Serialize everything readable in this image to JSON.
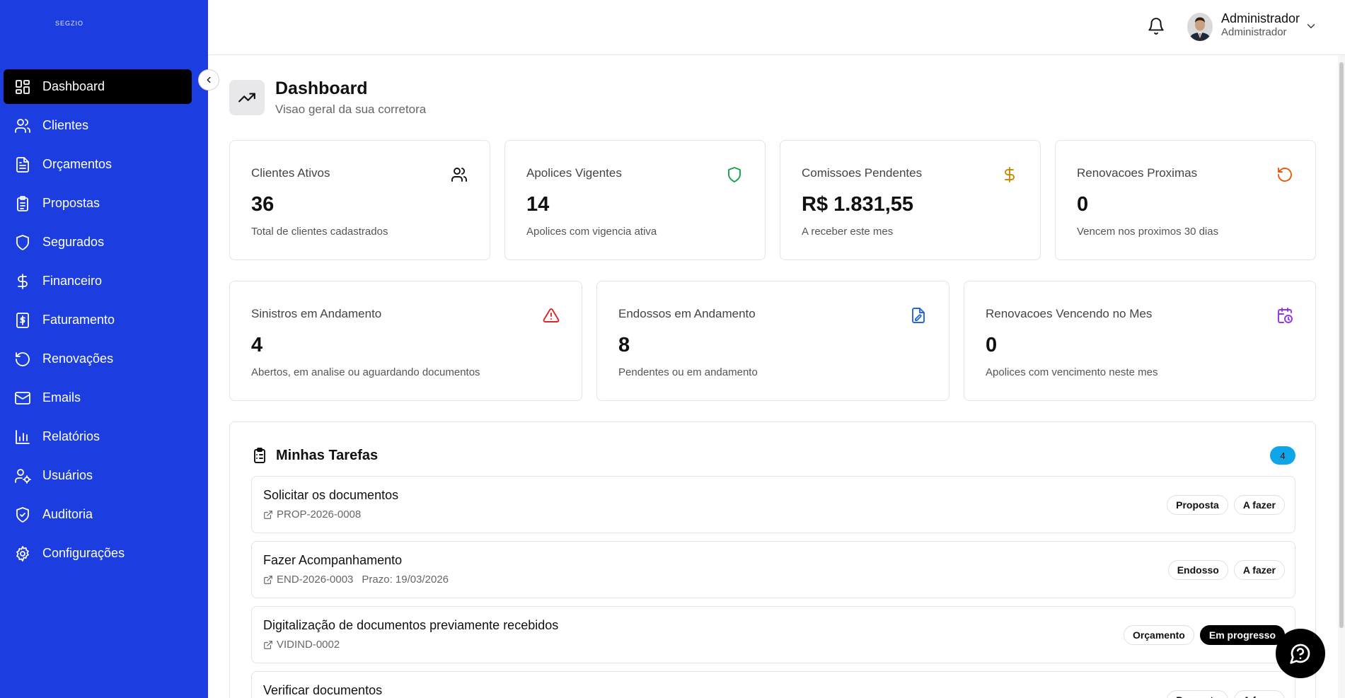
{
  "app": {
    "brand": "SEGZIO"
  },
  "sidebar": {
    "items": [
      {
        "label": "Dashboard",
        "icon": "dashboard-icon",
        "active": true
      },
      {
        "label": "Clientes",
        "icon": "users-icon"
      },
      {
        "label": "Orçamentos",
        "icon": "file-text-icon"
      },
      {
        "label": "Propostas",
        "icon": "clipboard-icon"
      },
      {
        "label": "Segurados",
        "icon": "shield-icon"
      },
      {
        "label": "Financeiro",
        "icon": "dollar-icon"
      },
      {
        "label": "Faturamento",
        "icon": "receipt-icon"
      },
      {
        "label": "Renovações",
        "icon": "rotate-icon"
      },
      {
        "label": "Emails",
        "icon": "mail-icon"
      },
      {
        "label": "Relatórios",
        "icon": "bar-chart-icon"
      },
      {
        "label": "Usuários",
        "icon": "user-cog-icon"
      },
      {
        "label": "Auditoria",
        "icon": "shield-check-icon"
      },
      {
        "label": "Configurações",
        "icon": "settings-icon"
      }
    ]
  },
  "header": {
    "user_name": "Administrador",
    "user_role": "Administrador"
  },
  "page": {
    "title": "Dashboard",
    "subtitle": "Visao geral da sua corretora"
  },
  "stats": {
    "clientes": {
      "label": "Clientes Ativos",
      "value": "36",
      "desc": "Total de clientes cadastrados",
      "icon": "users-icon",
      "color": "#111111"
    },
    "apolices": {
      "label": "Apolices Vigentes",
      "value": "14",
      "desc": "Apolices com vigencia ativa",
      "icon": "shield-icon",
      "color": "#16a34a"
    },
    "comissoes": {
      "label": "Comissoes Pendentes",
      "value": "R$ 1.831,55",
      "desc": "A receber este mes",
      "icon": "dollar-icon",
      "color": "#ca8a04"
    },
    "renovacoes": {
      "label": "Renovacoes Proximas",
      "value": "0",
      "desc": "Vencem nos proximos 30 dias",
      "icon": "rotate-icon",
      "color": "#ea580c"
    },
    "sinistros": {
      "label": "Sinistros em Andamento",
      "value": "4",
      "desc": "Abertos, em analise ou aguardando documentos",
      "icon": "alert-triangle-icon",
      "color": "#dc2626"
    },
    "endossos": {
      "label": "Endossos em Andamento",
      "value": "8",
      "desc": "Pendentes ou em andamento",
      "icon": "file-edit-icon",
      "color": "#2563eb"
    },
    "vencendo": {
      "label": "Renovacoes Vencendo no Mes",
      "value": "0",
      "desc": "Apolices com vencimento neste mes",
      "icon": "calendar-clock-icon",
      "color": "#9333ea"
    }
  },
  "tasks": {
    "title": "Minhas Tarefas",
    "count": "4",
    "items": [
      {
        "title": "Solicitar os documentos",
        "ref": "PROP-2026-0008",
        "deadline": "",
        "tags": [
          "Proposta",
          "A fazer"
        ]
      },
      {
        "title": "Fazer Acompanhamento",
        "ref": "END-2026-0003",
        "deadline": "Prazo: 19/03/2026",
        "tags": [
          "Endosso",
          "A fazer"
        ]
      },
      {
        "title": "Digitalização de documentos previamente recebidos",
        "ref": "VIDIND-0002",
        "deadline": "",
        "tags": [
          "Orçamento",
          "Em progresso"
        ]
      },
      {
        "title": "Verificar documentos",
        "ref": "",
        "deadline": "",
        "tags": [
          "Proposta",
          "A fazer"
        ]
      }
    ]
  }
}
